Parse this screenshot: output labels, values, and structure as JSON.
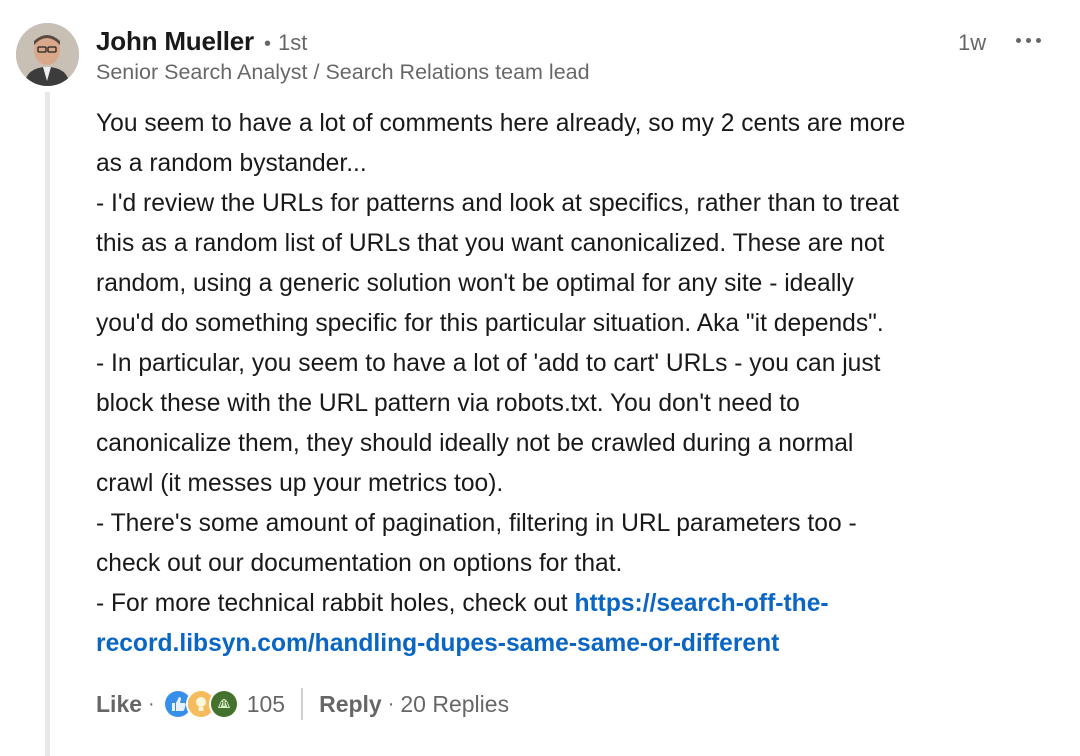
{
  "author": {
    "name": "John Mueller",
    "connection_degree": "1st",
    "headline": "Senior Search Analyst / Search Relations team lead"
  },
  "timestamp": "1w",
  "menu_icon": "ellipsis-icon",
  "comment": {
    "lines": [
      "You seem to have a lot of comments here already, so my 2 cents are more",
      "as a random bystander...",
      "- I'd review the URLs for patterns and look at specifics, rather than to treat",
      "this as a random list of URLs that you want canonicalized. These are not",
      "random, using a generic solution won't be optimal for any site - ideally",
      "you'd do something specific for this particular situation. Aka \"it depends\".",
      "- In particular, you seem to have a lot of 'add to cart' URLs - you can just",
      "block these with the URL pattern via robots.txt. You don't need to",
      "canonicalize them, they should ideally not be crawled during a normal",
      "crawl (it messes up your metrics too).",
      "- There's some amount of pagination, filtering in URL parameters too -",
      "check out our documentation on options for that."
    ],
    "last_prefix": "- For more technical rabbit holes, check out ",
    "link_line1": "https://search-off-the-",
    "link_line2": "record.libsyn.com/handling-dupes-same-same-or-different"
  },
  "actions": {
    "like_label": "Like",
    "reaction_icons": [
      "like-reaction-icon",
      "insightful-reaction-icon",
      "celebrate-reaction-icon"
    ],
    "reaction_count": "105",
    "reply_label": "Reply",
    "replies_label": "20 Replies"
  },
  "colors": {
    "link": "#0a66c2",
    "like_reaction": "#378fe9",
    "insightful_reaction": "#f5bb5c",
    "celebrate_reaction": "#44712e"
  }
}
